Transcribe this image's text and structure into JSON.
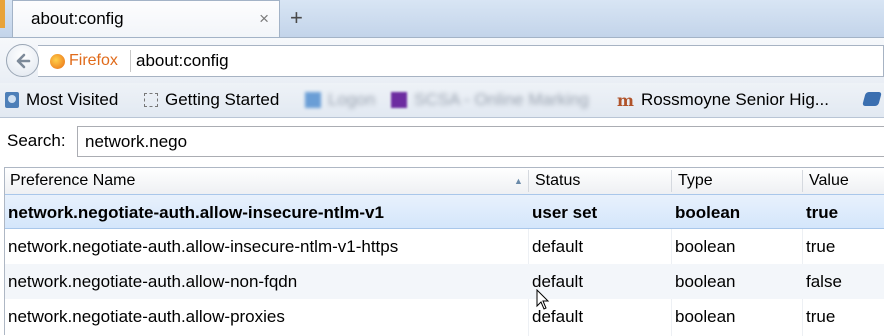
{
  "tab": {
    "title": "about:config",
    "close_glyph": "×",
    "new_tab_glyph": "+"
  },
  "nav": {
    "identity_label": "Firefox",
    "url": "about:config"
  },
  "bookmarks": {
    "items": [
      {
        "label": "Most Visited",
        "icon": "most-visited-icon"
      },
      {
        "label": "Getting Started",
        "icon": "page-icon"
      },
      {
        "label": "Logon",
        "icon": "blurred-site-icon"
      },
      {
        "label": "SCSA - Online Marking",
        "icon": "blurred-site-icon"
      },
      {
        "label": "Rossmoyne Senior Hig...",
        "icon": "moodle-icon"
      }
    ]
  },
  "search": {
    "label": "Search:",
    "value": "network.nego"
  },
  "table": {
    "columns": [
      "Preference Name",
      "Status",
      "Type",
      "Value"
    ],
    "rows": [
      {
        "name": "network.negotiate-auth.allow-insecure-ntlm-v1",
        "status": "user set",
        "type": "boolean",
        "value": "true"
      },
      {
        "name": "network.negotiate-auth.allow-insecure-ntlm-v1-https",
        "status": "default",
        "type": "boolean",
        "value": "true"
      },
      {
        "name": "network.negotiate-auth.allow-non-fqdn",
        "status": "default",
        "type": "boolean",
        "value": "false"
      },
      {
        "name": "network.negotiate-auth.allow-proxies",
        "status": "default",
        "type": "boolean",
        "value": "true"
      }
    ]
  }
}
